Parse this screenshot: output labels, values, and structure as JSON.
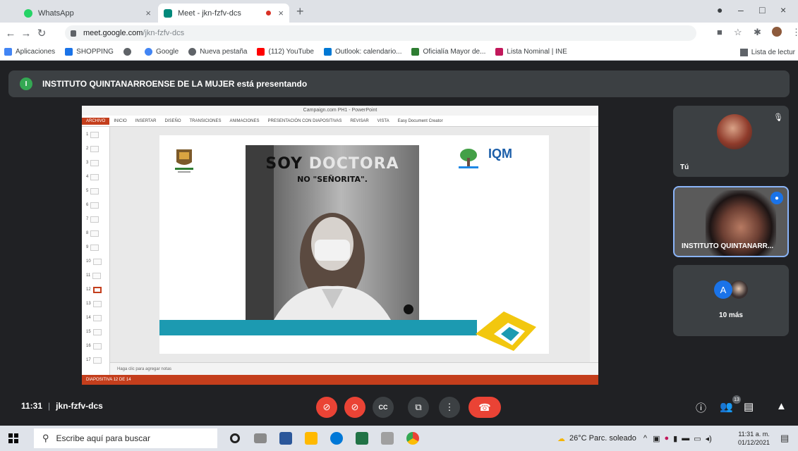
{
  "browser": {
    "tabs": [
      {
        "title": "WhatsApp",
        "active": false
      },
      {
        "title": "Meet - jkn-fzfv-dcs",
        "active": true
      }
    ],
    "new_tab_symbol": "+",
    "window_controls": {
      "minimize": "–",
      "maximize": "□",
      "close": "×"
    },
    "url_host": "meet.google.com",
    "url_path": "/jkn-fzfv-dcs",
    "bookmarks": [
      {
        "label": "Aplicaciones",
        "icon": "apps-grid-icon",
        "color": "#4285f4"
      },
      {
        "label": "SHOPPING",
        "icon": "shopping-icon",
        "color": "#1a73e8"
      },
      {
        "label": "",
        "icon": "globe-icon",
        "color": "#5f6368"
      },
      {
        "label": "Google",
        "icon": "google-icon",
        "color": "#4285f4"
      },
      {
        "label": "Nueva pestaña",
        "icon": "globe-icon",
        "color": "#5f6368"
      },
      {
        "label": "(112) YouTube",
        "icon": "youtube-icon",
        "color": "#ff0000"
      },
      {
        "label": "Outlook: calendario...",
        "icon": "outlook-icon",
        "color": "#0078d4"
      },
      {
        "label": "Oficialía Mayor de...",
        "icon": "leaf-icon",
        "color": "#2e7d32"
      },
      {
        "label": "Lista Nominal | INE",
        "icon": "ine-icon",
        "color": "#c2185b"
      }
    ],
    "bookmark_right": "Lista de lectur"
  },
  "meet": {
    "banner_avatar_letter": "I",
    "presenting_text": "INSTITUTO QUINTANARROENSE DE LA MUJER está presentando",
    "meeting_time": "11:31",
    "meeting_code": "jkn-fzfv-dcs",
    "participants_badge": "13",
    "tiles": [
      {
        "name": "Tú"
      },
      {
        "name": "INSTITUTO QUINTANARR..."
      },
      {
        "name": "10 más",
        "avatar_letter": "A"
      }
    ],
    "controls": [
      {
        "name": "mic-toggle",
        "icon": "mic-off-icon",
        "color": "#ea4335"
      },
      {
        "name": "camera-toggle",
        "icon": "camera-off-icon",
        "color": "#ea4335"
      },
      {
        "name": "captions",
        "icon": "captions-icon",
        "color": "#3c4043"
      },
      {
        "name": "present",
        "icon": "present-icon",
        "color": "#3c4043"
      },
      {
        "name": "more-options",
        "icon": "more-vert-icon",
        "color": "#3c4043"
      },
      {
        "name": "leave-call",
        "icon": "hangup-icon",
        "color": "#ea4335"
      }
    ]
  },
  "powerpoint": {
    "window_title": "Campaign.com PH1 - PowerPoint",
    "ribbon_tabs": [
      "ARCHIVO",
      "INICIO",
      "INSERTAR",
      "DISEÑO",
      "TRANSICIONES",
      "ANIMACIONES",
      "PRESENTACIÓN CON DIAPOSITIVAS",
      "REVISAR",
      "VISTA",
      "Easy Document Creator"
    ],
    "notes_placeholder": "Haga clic para agregar notas",
    "status_text": "DIAPOSITIVA 12 DE 14",
    "selected_slide": 12,
    "slide": {
      "headline_part1": "SOY",
      "headline_part2": "DOCTORA",
      "subheadline": "NO \"SEÑORITA\".",
      "org_logo_text": "IQM"
    }
  },
  "taskbar": {
    "search_placeholder": "Escribe aquí para buscar",
    "weather": "26°C  Parc. soleado",
    "time": "11:31 a. m.",
    "date": "01/12/2021"
  }
}
